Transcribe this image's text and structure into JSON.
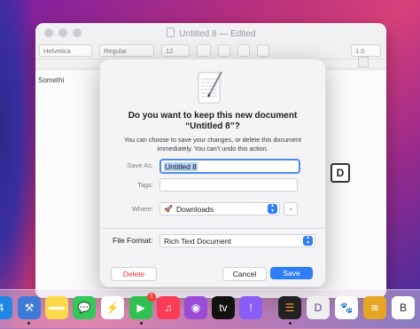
{
  "window": {
    "title": "Untitled 8",
    "title_suffix": "— Edited",
    "toolbar": {
      "font_family": "Helvetica",
      "font_style": "Regular",
      "font_size": "12",
      "line_spacing": "1.0"
    },
    "body_text": "Somethi"
  },
  "dialog": {
    "heading_line1": "Do you want to keep this new document",
    "heading_line2": "“Untitled 8”?",
    "description": "You can choose to save your changes, or delete this document immediately. You can’t undo this action.",
    "save_as_label": "Save As:",
    "save_as_value": "Untitled 8",
    "tags_label": "Tags:",
    "where_label": "Where:",
    "where_value": "Downloads",
    "file_format_label": "File Format:",
    "file_format_value": "Rich Text Document",
    "delete_label": "Delete",
    "cancel_label": "Cancel",
    "save_label": "Save"
  },
  "dock": {
    "facetime_badge": "1",
    "apps": [
      "app-store-icon",
      "xcode-icon",
      "notes-icon",
      "messages-icon",
      "messenger-icon",
      "facetime-icon",
      "music-icon",
      "podcasts-icon",
      "appletv-icon",
      "feedback-icon",
      "mosaic-icon",
      "dash-icon",
      "paw-icon",
      "stack-icon",
      "bbedit-icon"
    ]
  },
  "colors": {
    "accent": "#2f7ef6",
    "destructive": "#e0382f"
  }
}
